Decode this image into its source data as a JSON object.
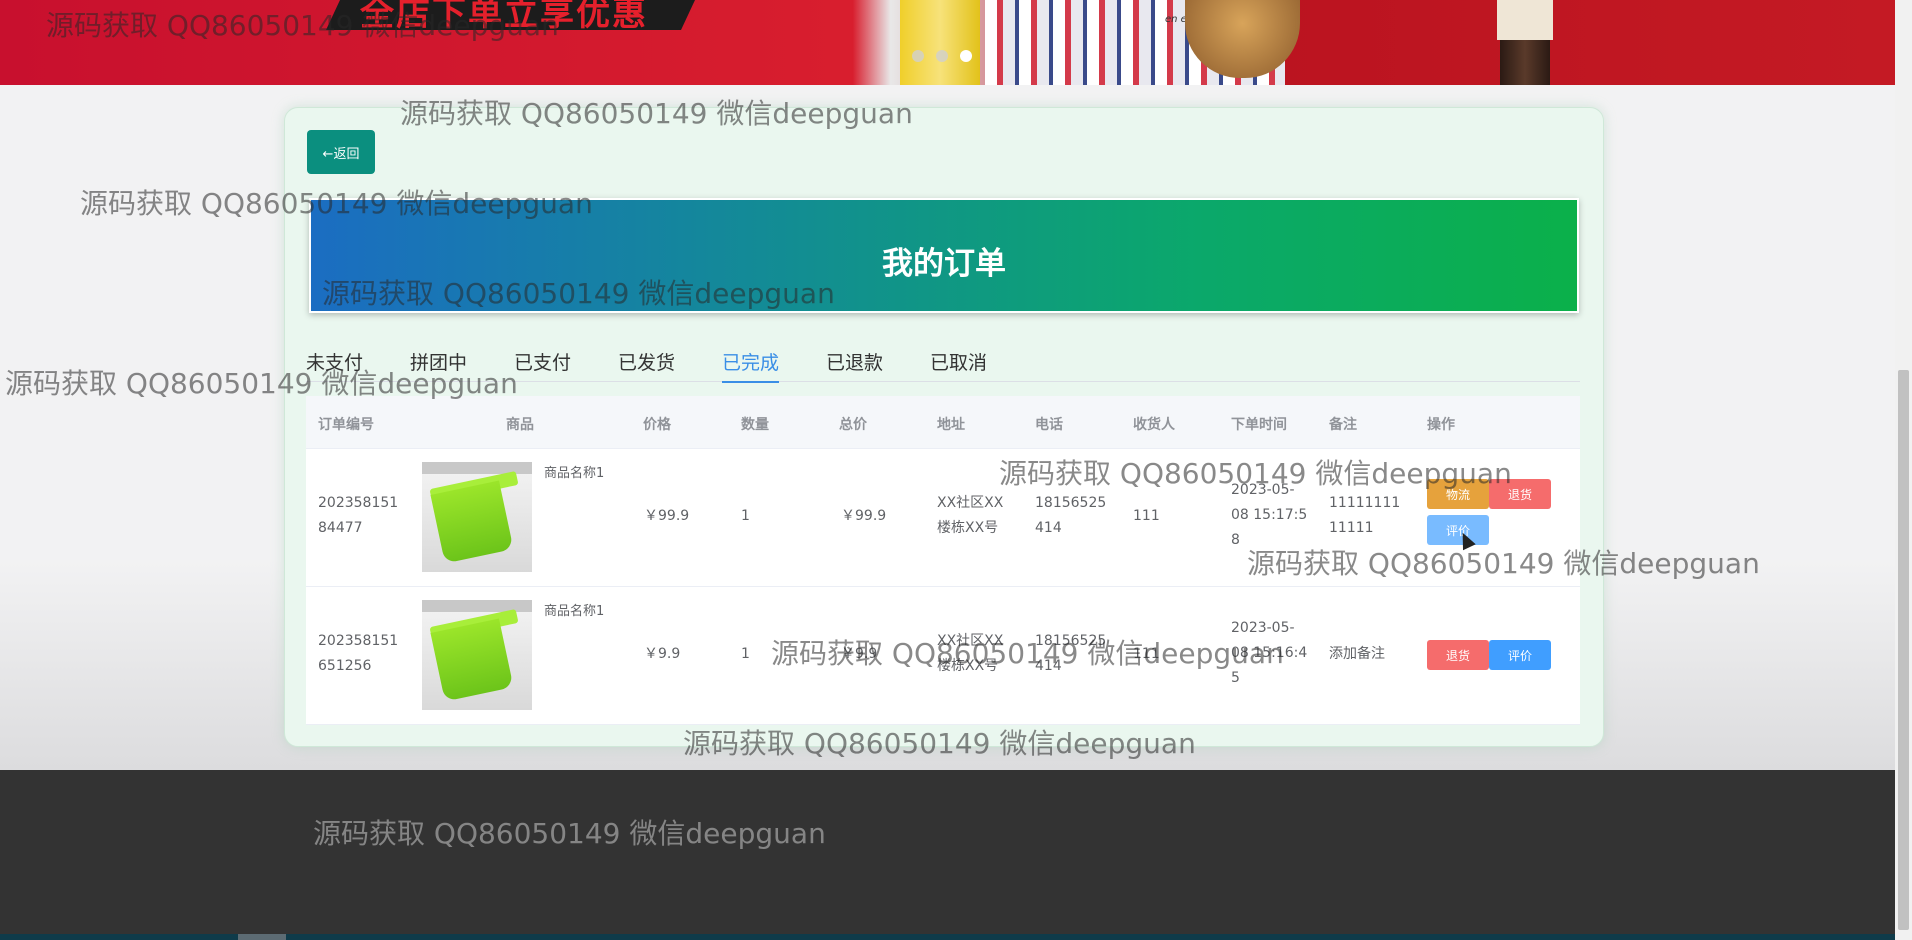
{
  "banner": {
    "promo_text": "全店下单立享优惠",
    "can_text": "",
    "stripes_text": "en ecoutant la p",
    "carousel_dots": 3,
    "carousel_active": 3
  },
  "header": {
    "back_label": "←返回",
    "title": "我的订单"
  },
  "tabs": [
    "未支付",
    "拼团中",
    "已支付",
    "已发货",
    "已完成",
    "已退款",
    "已取消"
  ],
  "active_tab": "已完成",
  "table": {
    "columns": [
      "订单编号",
      "商品",
      "价格",
      "数量",
      "总价",
      "地址",
      "电话",
      "收货人",
      "下单时间",
      "备注",
      "操作"
    ],
    "rows": [
      {
        "order_no": "20235815184477",
        "order_no_lines": [
          "202358151",
          "84477"
        ],
        "product": "商品名称1",
        "price": "￥99.9",
        "qty": "1",
        "total": "￥99.9",
        "address_lines": [
          "XX社区XX",
          "楼栋XX号"
        ],
        "phone_lines": [
          "18156525",
          "414"
        ],
        "receiver": "111",
        "time_lines": [
          "2023-05-",
          "08 15:17:5",
          "8"
        ],
        "note_lines": [
          "11111111",
          "11111"
        ],
        "actions": [
          "物流",
          "退货",
          "评价"
        ]
      },
      {
        "order_no": "202358151651256",
        "order_no_lines": [
          "202358151",
          "651256"
        ],
        "product": "商品名称1",
        "price": "￥9.9",
        "qty": "1",
        "total": "￥9.9",
        "address_lines": [
          "XX社区XX",
          "楼栋XX号"
        ],
        "phone_lines": [
          "18156525",
          "414"
        ],
        "receiver": "111",
        "time_lines": [
          "2023-05-",
          "08 15:16:4",
          "5"
        ],
        "note_lines": [
          "添加备注"
        ],
        "actions": [
          "退货",
          "评价"
        ]
      }
    ]
  },
  "watermark": "源码获取 QQ86050149 微信deepguan",
  "colors": {
    "accent": "#3a8ee6",
    "back_button": "#0b8f7f",
    "warn": "#e6a23c",
    "danger": "#f56c6c",
    "primary": "#409eff",
    "footer": "#333333"
  }
}
